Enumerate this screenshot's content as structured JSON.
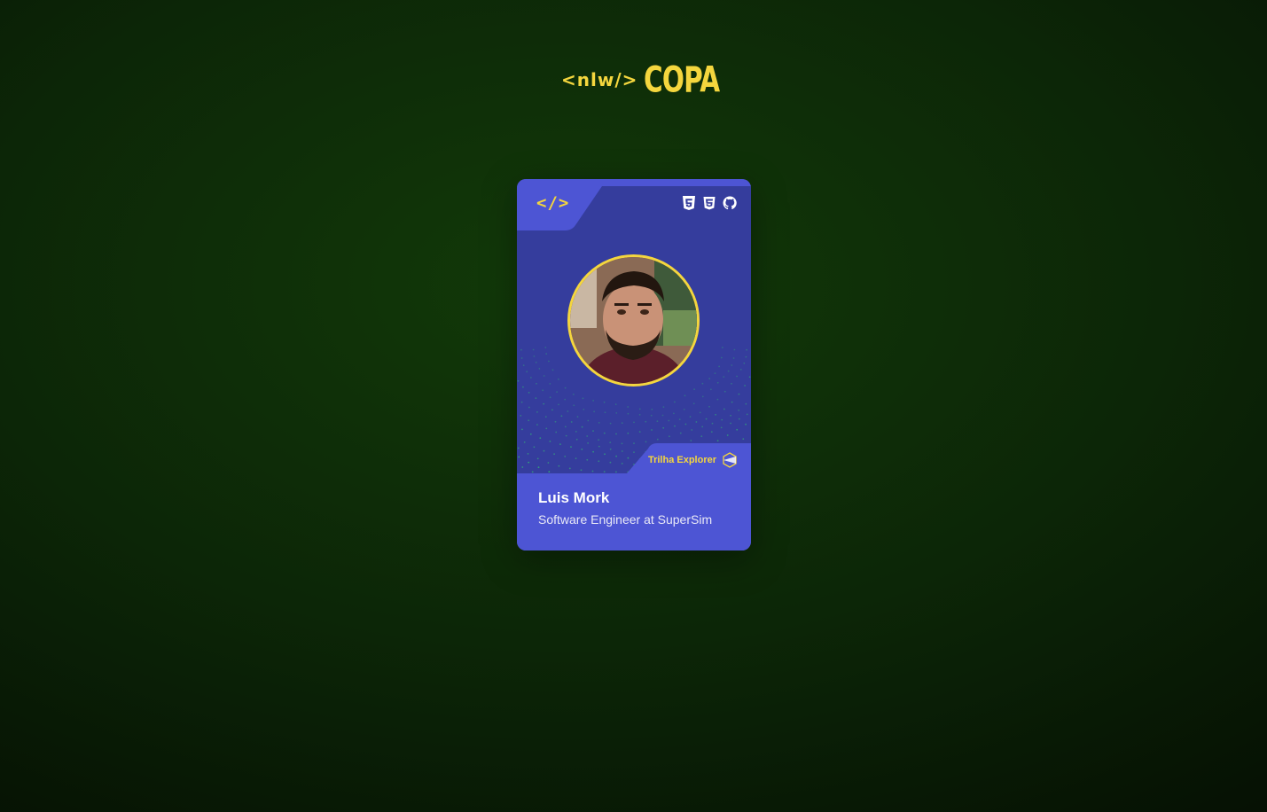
{
  "header": {
    "logo_nlw": "<nlw/>",
    "logo_copa": "COPA",
    "accent_color": "#f4d63e"
  },
  "card": {
    "code_icon": "</>",
    "tech_icons": [
      "html5-icon",
      "css3-icon",
      "github-icon"
    ],
    "track_label": "Trilha Explorer",
    "track_icon": "explorer-logo-icon",
    "avatar": "profile-photo",
    "name": "Luis Mork",
    "role": "Software Engineer at SuperSim",
    "colors": {
      "card_top": "#353d9d",
      "card_bottom": "#4d55d4",
      "dots": "#2fbf71"
    }
  }
}
